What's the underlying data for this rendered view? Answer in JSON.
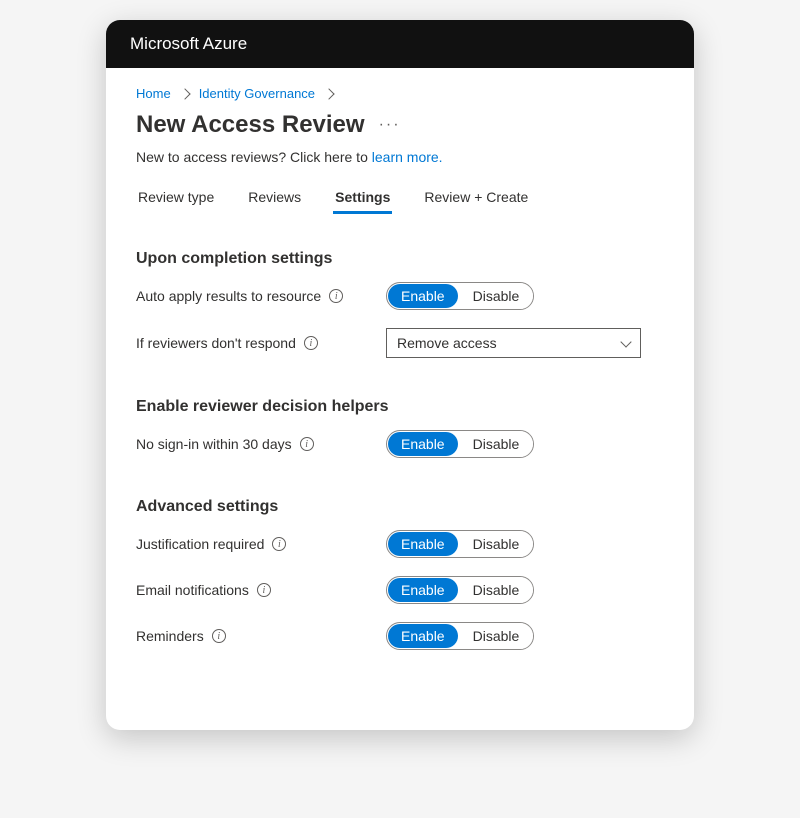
{
  "titlebar": "Microsoft Azure",
  "breadcrumb": {
    "home": "Home",
    "identity": "Identity Governance"
  },
  "page_title": "New Access Review",
  "more_icon": "···",
  "subtext_prefix": "New to access reviews? Click here to ",
  "subtext_link": "learn more.",
  "tabs": {
    "review_type": "Review type",
    "reviews": "Reviews",
    "settings": "Settings",
    "review_create": "Review + Create"
  },
  "sections": {
    "completion": {
      "header": "Upon completion settings",
      "auto_apply": "Auto apply results to resource",
      "if_reviewers": "If reviewers don't respond",
      "select_value": "Remove access"
    },
    "helpers": {
      "header": "Enable reviewer decision helpers",
      "no_signin": "No sign-in within 30 days"
    },
    "advanced": {
      "header": "Advanced settings",
      "justification": "Justification required",
      "email": "Email notifications",
      "reminders": "Reminders"
    }
  },
  "toggle": {
    "enable": "Enable",
    "disable": "Disable"
  }
}
